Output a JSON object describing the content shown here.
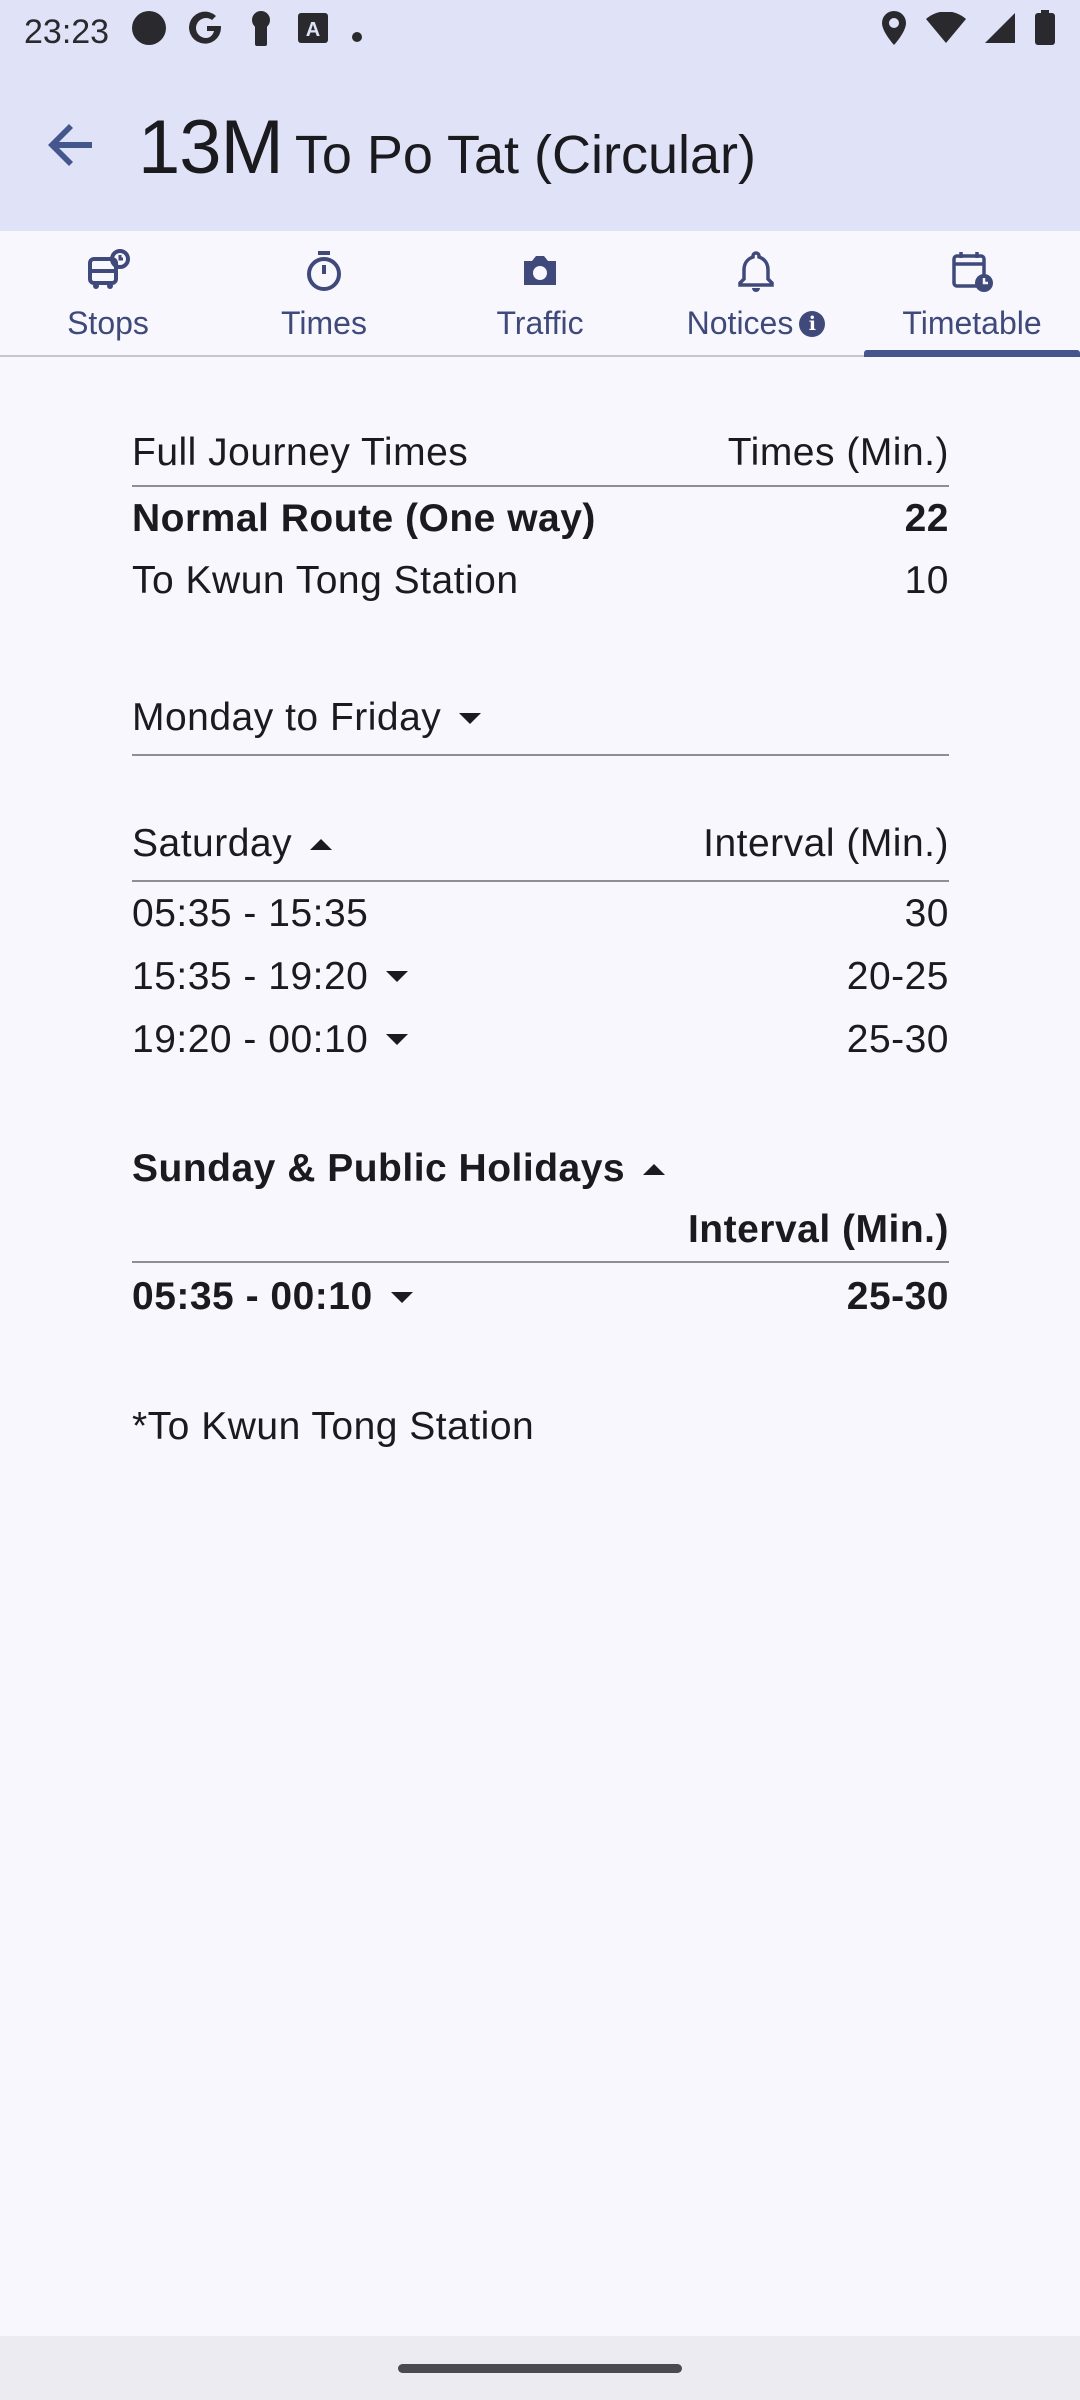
{
  "status_bar": {
    "time": "23:23",
    "left_icons": [
      "circle-notification-icon",
      "google-icon",
      "keyhole-icon",
      "a-box-icon",
      "dot-icon"
    ],
    "right_icons": [
      "location-icon",
      "wifi-icon",
      "signal-icon",
      "battery-icon"
    ]
  },
  "app_bar": {
    "route_number": "13M",
    "destination": "To Po Tat (Circular)"
  },
  "tabs": [
    {
      "label": "Stops",
      "icon": "bus-stop-icon",
      "active": false
    },
    {
      "label": "Times",
      "icon": "stopwatch-icon",
      "active": false
    },
    {
      "label": "Traffic",
      "icon": "camera-icon",
      "active": false
    },
    {
      "label": "Notices",
      "icon": "bell-icon",
      "active": false
    },
    {
      "label": "Timetable",
      "icon": "calendar-clock-icon",
      "active": true
    }
  ],
  "journey": {
    "header_left": "Full Journey Times",
    "header_right": "Times (Min.)",
    "rows": [
      {
        "label": "Normal Route (One way)",
        "value": "22"
      },
      {
        "label": "To Kwun Tong Station",
        "value": "10"
      }
    ]
  },
  "weekday": {
    "label": "Monday to Friday"
  },
  "saturday": {
    "label": "Saturday",
    "interval_header": "Interval (Min.)",
    "rows": [
      {
        "time": "05:35 - 15:35",
        "interval": "30"
      },
      {
        "time": "15:35 - 19:20",
        "interval": "20-25"
      },
      {
        "time": "19:20 - 00:10",
        "interval": "25-30"
      }
    ]
  },
  "sunday": {
    "label": "Sunday & Public Holidays",
    "interval_header": "Interval (Min.)",
    "rows": [
      {
        "time": "05:35 - 00:10",
        "interval": "25-30"
      }
    ]
  },
  "footnote": "*To Kwun Tong Station",
  "colors": {
    "app_bar_bg": "#e0e3f8",
    "page_bg": "#f8f7fd",
    "tab_accent": "#45568d"
  }
}
